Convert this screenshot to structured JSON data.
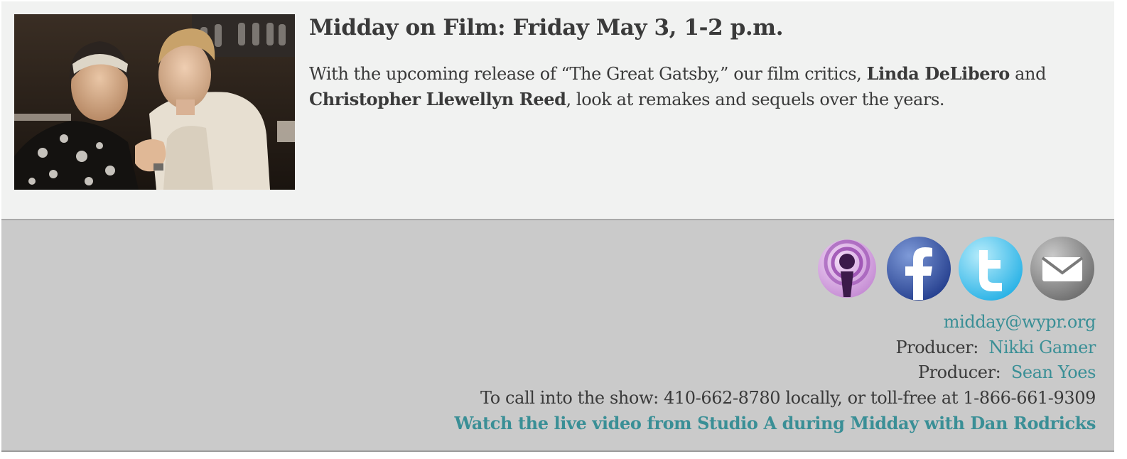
{
  "segment": {
    "title": "Midday on Film: Friday May 3, 1-2 p.m.",
    "desc_before": "With the upcoming release of “The Great Gatsby,” our film critics, ",
    "critic_1": "Linda DeLibero",
    "desc_and": " and ",
    "critic_2": "Christopher Llewellyn Reed",
    "desc_after": ",  look at remakes and sequels over the years."
  },
  "social": {
    "icons": [
      "podcast-icon",
      "facebook-icon",
      "twitter-icon",
      "email-icon"
    ]
  },
  "footer": {
    "email": "midday@wypr.org",
    "producer_label_1": "Producer:",
    "producer_1": "Nikki Gamer",
    "producer_label_2": "Producer:",
    "producer_2": "Sean Yoes",
    "call_in": "To call into the show: 410-662-8780 locally, or toll-free at 1-866-661-9309",
    "live_video": "Watch the live video from Studio A during Midday with Dan Rodricks"
  },
  "colors": {
    "link": "#3a8f96",
    "text": "#3a3a3a",
    "top_bg": "#f1f2f1",
    "bottom_bg": "#cacaca"
  }
}
